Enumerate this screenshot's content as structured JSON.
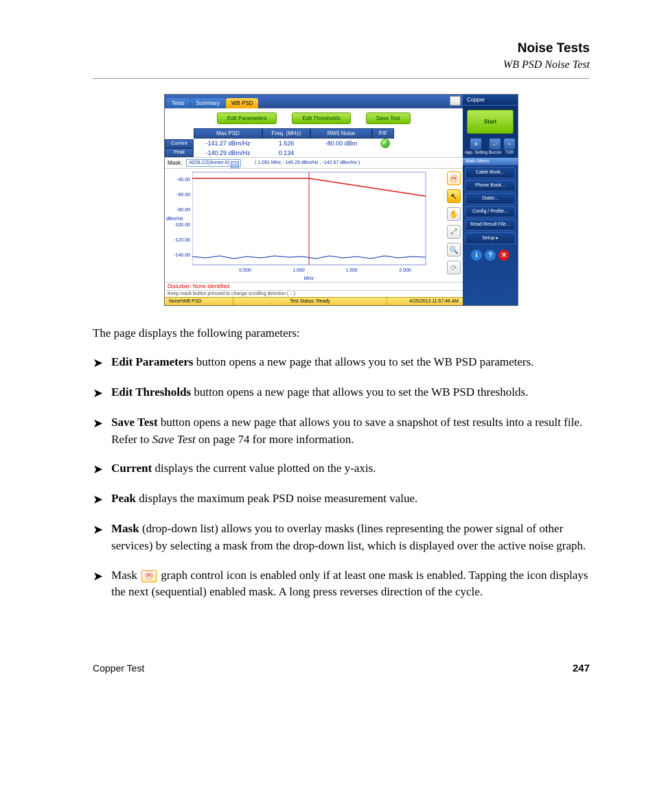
{
  "header": {
    "title": "Noise Tests",
    "subtitle": "WB PSD Noise Test"
  },
  "screenshot": {
    "tabs": {
      "tests": "Tests",
      "summary": "Summary",
      "wbpsd": "WB PSD"
    },
    "buttons": {
      "edit_params": "Edit Parameters",
      "edit_thresh": "Edit Thresholds",
      "save_test": "Save Test"
    },
    "table_headers": {
      "max_psd": "Max PSD",
      "freq": "Freq. (MHz)",
      "rms": "RMS Noise",
      "pf": "P/F"
    },
    "rows": {
      "current": {
        "label": "Current",
        "max_psd": "-141.27 dBm/Hz",
        "freq": "1.626",
        "rms": "-80.00 dBm"
      },
      "peak": {
        "label": "Peak",
        "max_psd": "-140.29 dBm/Hz",
        "freq": "0.134"
      }
    },
    "mask": {
      "label": "Mask:",
      "value": "ADSL1/2(Annex A)"
    },
    "cursor_readout": "( 1.091 MHz, -145.29 dBm/Hz , -142.67 dBm/Hz  )",
    "yaxis_label": "dBm/Hz",
    "yticks": [
      "-40.00",
      "-60.00",
      "-80.00",
      "-100.00",
      "-120.00",
      "-140.00"
    ],
    "xticks": [
      "0.500",
      "1.000",
      "1.500",
      "2.000"
    ],
    "xaxis_label": "MHz",
    "disturber": "Disturber: None identified",
    "hint": "Keep mask button pressed to change scrolling direction ( ↓ ).",
    "status": {
      "path": "Noise\\WB PSD",
      "state": "Test Status: Ready",
      "time": "4/25/2013 11:57:46 AM"
    },
    "sidebar": {
      "title": "Copper",
      "start": "Start",
      "icons": {
        "app": "App. Setting",
        "buzzer": "Buzzer",
        "tdr": "TDR"
      },
      "menu_header": "Main Menu",
      "items": [
        "Cable Book...",
        "Phone Book...",
        "Dialer...",
        "Config / Profile...",
        "Read Result File...",
        "Setup        ▸"
      ]
    }
  },
  "body": {
    "intro": "The page displays the following parameters:",
    "bullets": [
      {
        "bold": "Edit Parameters",
        "rest": " button opens a new page that allows you to set the WB PSD parameters."
      },
      {
        "bold": "Edit Thresholds",
        "rest": " button opens a new page that allows you to set the WB PSD thresholds."
      },
      {
        "bold": "Save Test",
        "rest": " button opens a new page that allows you to save a snapshot of test results into a result file. Refer to ",
        "italic": "Save Test",
        "rest2": " on page 74 for more information."
      },
      {
        "bold": "Current",
        "rest": " displays the current value plotted on the y-axis."
      },
      {
        "bold": "Peak",
        "rest": " displays the maximum peak PSD noise measurement value."
      },
      {
        "bold": "Mask",
        "rest": " (drop-down list) allows you to overlay masks (lines representing the power signal of other services) by selecting a mask from the drop-down list, which is displayed over the active noise graph."
      }
    ],
    "last_bullet": {
      "pre": "Mask ",
      "post": " graph control icon is enabled only if at least one mask is enabled. Tapping the icon displays the next (sequential) enabled mask. A long press reverses direction of the cycle."
    }
  },
  "footer": {
    "left": "Copper Test",
    "right": "247"
  },
  "chart_data": {
    "type": "line",
    "xlabel": "MHz",
    "ylabel": "dBm/Hz",
    "xlim": [
      0,
      2.2
    ],
    "ylim": [
      -150,
      -30
    ],
    "series": [
      {
        "name": "Mask",
        "color": "#d81a1a",
        "x": [
          0,
          1.1,
          2.2
        ],
        "y": [
          -40,
          -40,
          -60
        ]
      },
      {
        "name": "Noise",
        "color": "#0b2faa",
        "x": [
          0,
          0.5,
          1.0,
          1.5,
          2.0,
          2.2
        ],
        "y": [
          -143,
          -144,
          -143,
          -145,
          -144,
          -143
        ]
      }
    ],
    "cursor_x": 1.091
  }
}
